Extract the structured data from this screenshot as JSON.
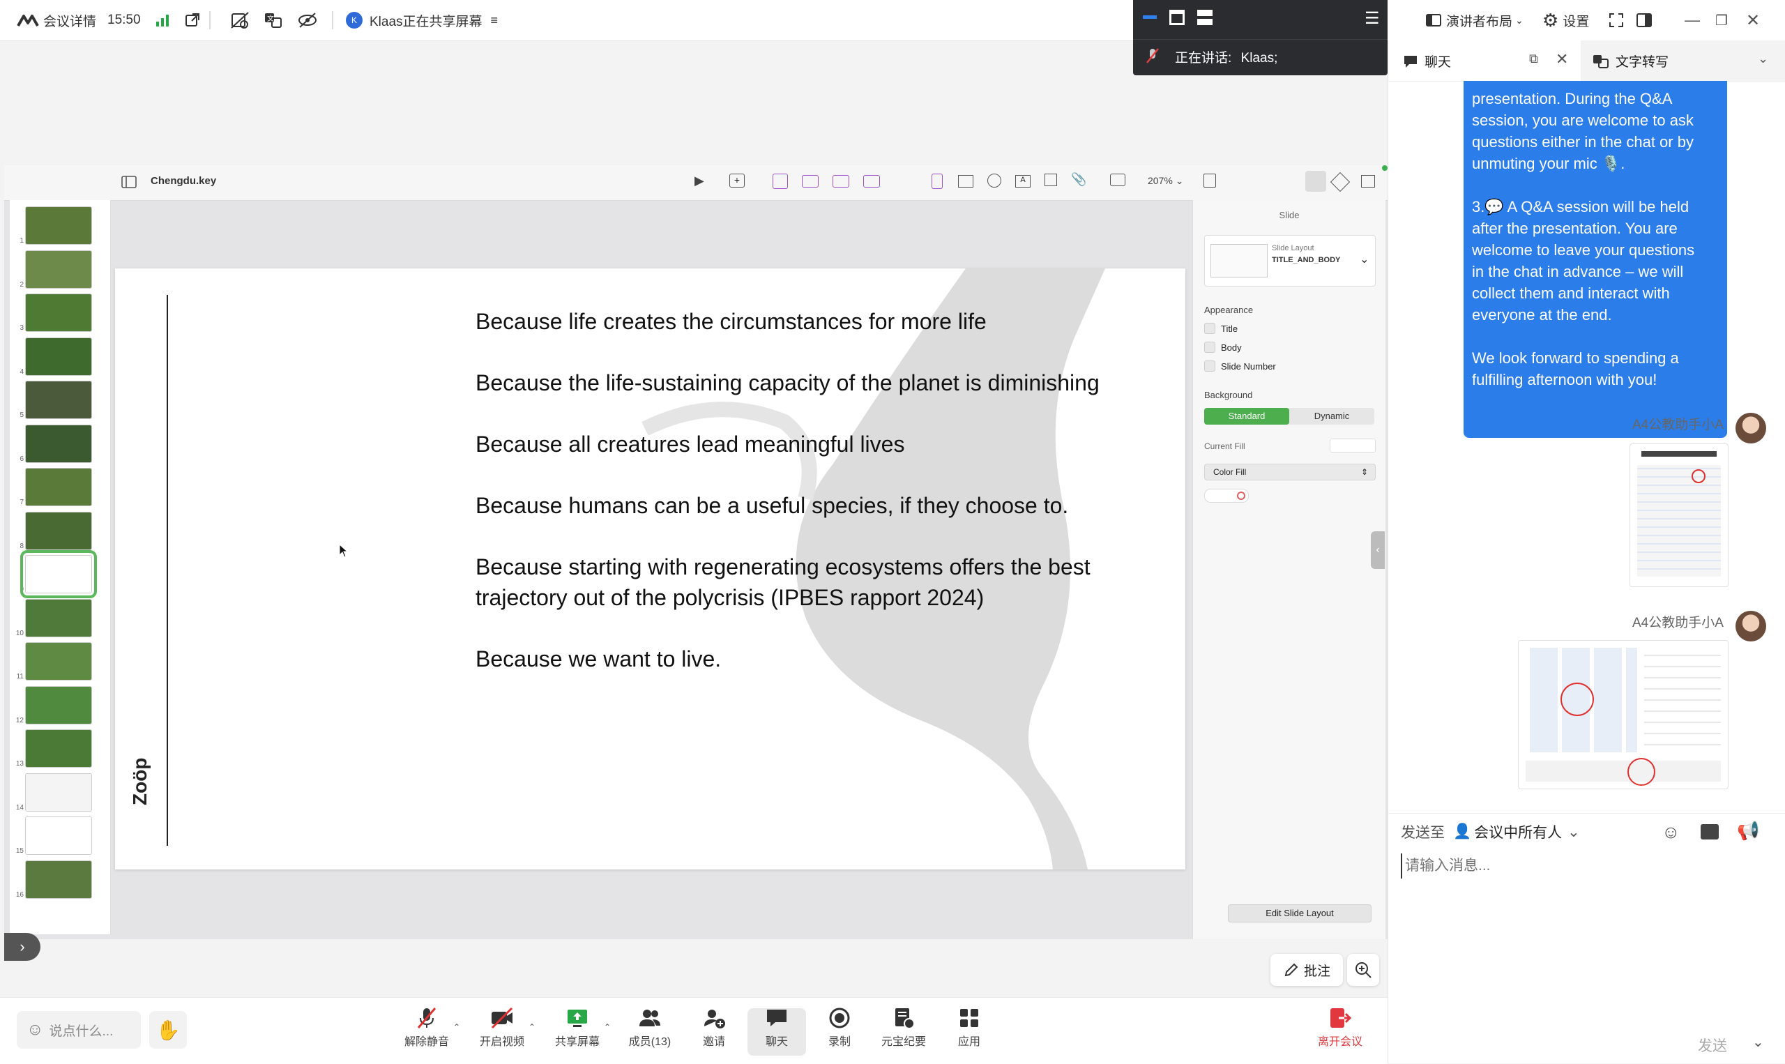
{
  "topbar": {
    "meeting_details": "会议详情",
    "time": "15:50",
    "share_status": "Klaas正在共享屏幕",
    "presenter_layout": "演讲者布局",
    "settings": "设置"
  },
  "speaker_panel": {
    "speaking_label": "正在讲话:",
    "speaker_name": "Klaas;"
  },
  "chat_tabs": {
    "chat": "聊天",
    "transcript": "文字转写"
  },
  "keynote": {
    "filename": "Chengdu.key",
    "zoom": "207%",
    "thumbnails": [
      "1",
      "2",
      "3",
      "4",
      "5",
      "6",
      "7",
      "8",
      "9",
      "10",
      "11",
      "12",
      "13",
      "14",
      "15",
      "16"
    ],
    "selected_thumbnail": 9
  },
  "slide": {
    "lines": [
      "Because life creates the circumstances for more life",
      "Because the life-sustaining capacity of the planet is diminishing",
      "Because all creatures lead meaningful lives",
      "Because humans can be a useful species, if they choose to.",
      "Because starting with regenerating ecosystems offers the best",
      "trajectory out of the polycrisis (IPBES rapport 2024)",
      "Because we want to live."
    ],
    "logo": "Zoöp"
  },
  "inspector": {
    "section_title": "Slide",
    "layout_label": "Slide Layout",
    "layout_value": "TITLE_AND_BODY",
    "appearance": "Appearance",
    "title_cb": "Title",
    "body_cb": "Body",
    "slide_number_cb": "Slide Number",
    "background": "Background",
    "standard": "Standard",
    "dynamic": "Dynamic",
    "current_fill": "Current Fill",
    "color_fill": "Color Fill",
    "edit_layout": "Edit Slide Layout"
  },
  "chat": {
    "message_lines": [
      "presentation. During the Q&A",
      "session, you are welcome to ask",
      "questions either in the chat or by",
      "unmuting your mic 🎙️.",
      "",
      "3.💬 A Q&A session will be held",
      "after the presentation. You are",
      "welcome to leave your questions",
      "in the chat in advance – we will",
      "collect them and interact with",
      "everyone at the end.",
      "",
      "We look forward to spending a",
      "fulfilling afternoon with you!"
    ],
    "sender1": "A4公教助手小A",
    "sender2": "A4公教助手小A",
    "send_to_label": "发送至",
    "recipient": "会议中所有人",
    "input_placeholder": "请输入消息...",
    "send_button": "发送"
  },
  "annotate": {
    "label": "批注"
  },
  "bottombar": {
    "say_placeholder": "说点什么...",
    "unmute": "解除静音",
    "start_video": "开启视频",
    "share_screen": "共享屏幕",
    "members": "成员(13)",
    "invite": "邀请",
    "chat": "聊天",
    "record": "录制",
    "yuanbao": "元宝纪要",
    "apps": "应用",
    "leave": "离开会议"
  },
  "colors": {
    "accent": "#1a73e8",
    "bubble": "#2b7de9",
    "keynote_green": "#5cb85c",
    "leave_red": "#e0383e"
  }
}
